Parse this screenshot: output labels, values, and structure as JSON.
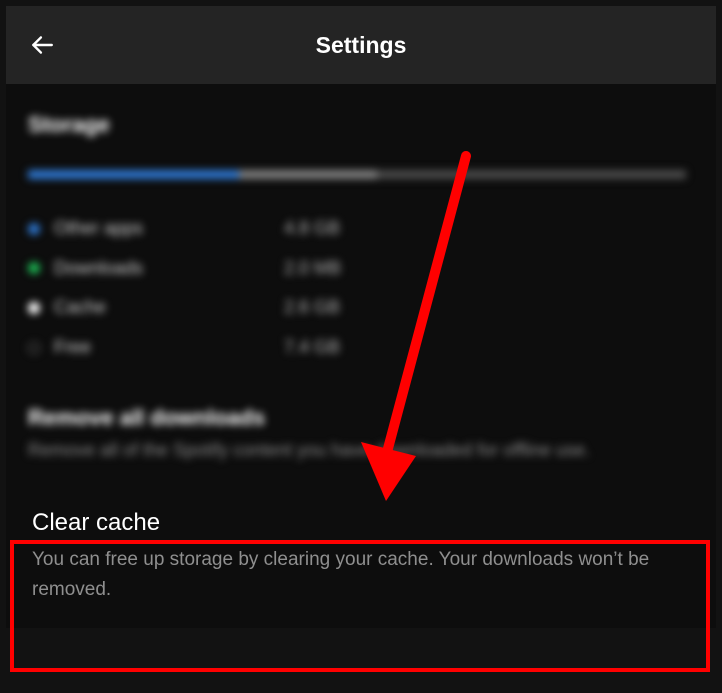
{
  "header": {
    "title": "Settings"
  },
  "storage": {
    "section_label": "Storage",
    "legend": [
      {
        "label": "Other apps",
        "value": "4.8 GB",
        "dot": "blue"
      },
      {
        "label": "Downloads",
        "value": "2.0 MB",
        "dot": "green"
      },
      {
        "label": "Cache",
        "value": "2.6 GB",
        "dot": "white"
      },
      {
        "label": "Free",
        "value": "7.4 GB",
        "dot": "hollow"
      }
    ]
  },
  "remove_downloads": {
    "title": "Remove all downloads",
    "description": "Remove all of the Spotify content you have downloaded for offline use."
  },
  "clear_cache": {
    "title": "Clear cache",
    "description": "You can free up storage by clearing your cache. Your downloads won’t be removed."
  }
}
